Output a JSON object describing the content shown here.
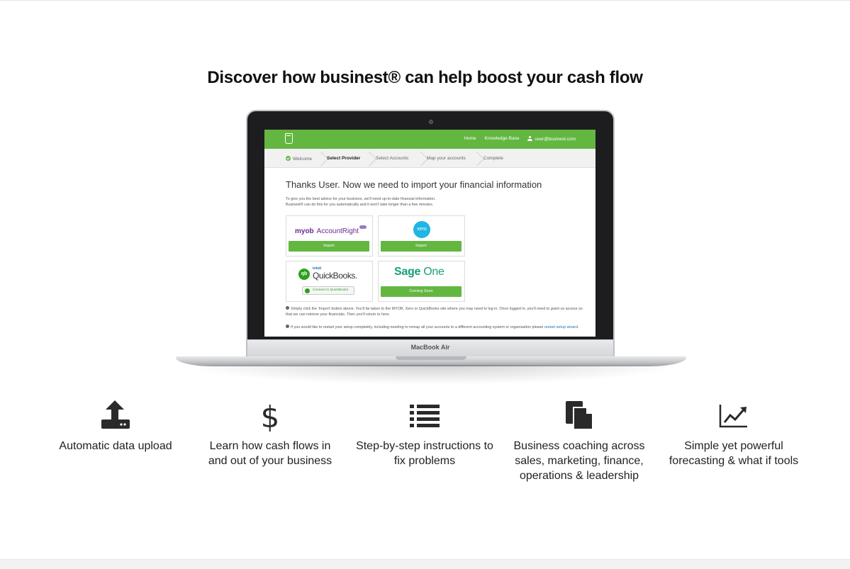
{
  "headline": "Discover how businest® can help boost your cash flow",
  "laptop": {
    "model_label": "MacBook Air"
  },
  "app": {
    "nav": {
      "home": "Home",
      "knowledge_base": "Knowledge Base",
      "user": "user@businest.com"
    },
    "steps": [
      "Welcome",
      "Select Provider",
      "Select Accounts",
      "Map your accounts",
      "Complete"
    ],
    "active_step": "Select Provider",
    "heading": "Thanks User. Now we need to import your financial information",
    "intro_line1": "To give you the best advice for your business, we'll need up-to-date financial information.",
    "intro_line2": "Businest® can do this for you automatically and it won't take longer than a few minutes.",
    "providers": {
      "myob": {
        "logo_text_bold": "myob",
        "logo_text": "AccountRight",
        "button": "Import"
      },
      "xero": {
        "logo_text": "xero",
        "button": "Import"
      },
      "quickbooks": {
        "logo_badge": "qb",
        "logo_brand": "intuit",
        "logo_text": "QuickBooks.",
        "button": "Connect to QuickBooks"
      },
      "sage": {
        "logo_text_bold": "Sage",
        "logo_text": "One",
        "button": "Coming Soon"
      }
    },
    "note1": "Simply click the 'Import' button above. You'll be taken to the MYOB, Xero or QuickBooks site where you may need to log in. Once logged in, you'll need to grant us access so that we can retrieve your financials. Then you'll return to here.",
    "note2_text": "If you would like to restart your setup completely, including needing to remap all your accounts to a different accounting system or organisation please",
    "note2_link": "restart setup wizard",
    "note2_end": "."
  },
  "features": [
    {
      "icon": "upload-icon",
      "label": "Automatic data upload"
    },
    {
      "icon": "dollar-icon",
      "label": "Learn how cash flows in and out of your business"
    },
    {
      "icon": "list-icon",
      "label": "Step-by-step instructions to fix problems"
    },
    {
      "icon": "documents-icon",
      "label": "Business coaching across sales, marketing, finance, operations & leadership"
    },
    {
      "icon": "chart-line-icon",
      "label": "Simple yet powerful forecasting & what if tools"
    }
  ],
  "colors": {
    "brand_green": "#63b741",
    "link_blue": "#1e6fc0",
    "icon_dark": "#2a2a2a"
  }
}
